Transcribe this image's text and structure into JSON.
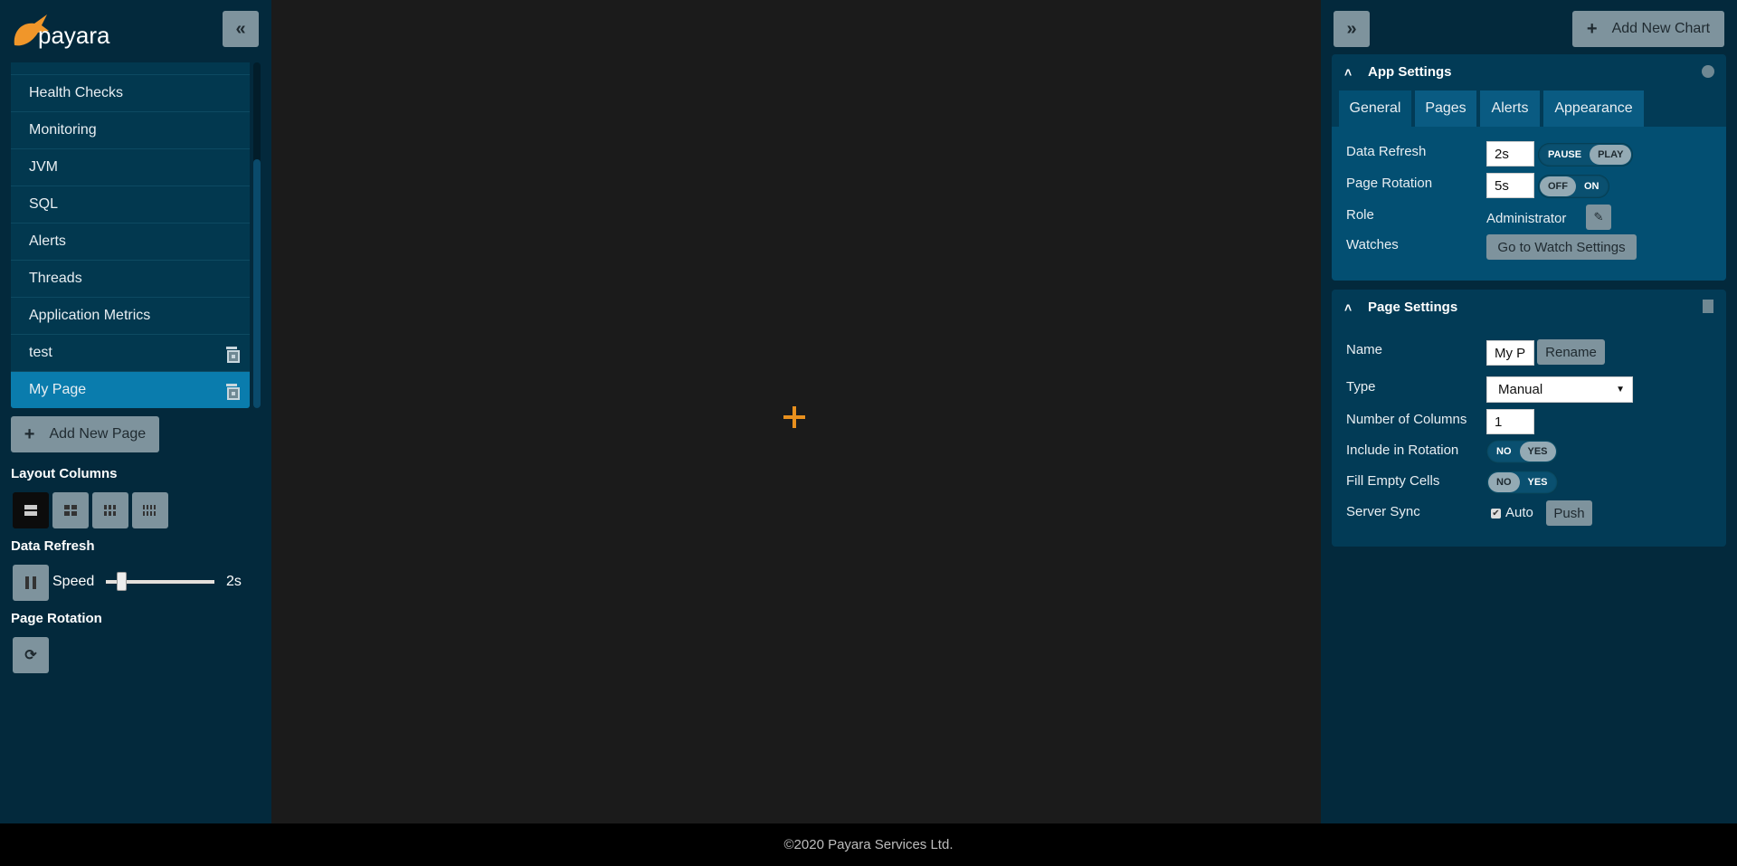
{
  "brand": {
    "logo_text": "payara"
  },
  "sidebar": {
    "items": [
      {
        "label": "Health Checks"
      },
      {
        "label": "Monitoring"
      },
      {
        "label": "JVM"
      },
      {
        "label": "SQL"
      },
      {
        "label": "Alerts"
      },
      {
        "label": "Threads"
      },
      {
        "label": "Application Metrics"
      },
      {
        "label": "test",
        "deletable": true
      },
      {
        "label": "My Page",
        "deletable": true,
        "active": true
      }
    ],
    "add_page_label": "Add New Page",
    "layout_columns_label": "Layout Columns",
    "layout_columns_selected": 1,
    "data_refresh_label": "Data Refresh",
    "speed_label": "Speed",
    "speed_value": "2s",
    "page_rotation_label": "Page Rotation"
  },
  "right": {
    "add_chart_label": "Add New Chart",
    "app_settings": {
      "title": "App Settings",
      "tabs": [
        "General",
        "Pages",
        "Alerts",
        "Appearance"
      ],
      "active_tab": "General",
      "data_refresh_label": "Data Refresh",
      "data_refresh_value": "2s",
      "pause": "PAUSE",
      "play": "PLAY",
      "page_rotation_label": "Page Rotation",
      "page_rotation_value": "5s",
      "off": "OFF",
      "on": "ON",
      "role_label": "Role",
      "role_value": "Administrator",
      "watches_label": "Watches",
      "watch_button": "Go to Watch Settings"
    },
    "page_settings": {
      "title": "Page Settings",
      "name_label": "Name",
      "name_value": "My P",
      "rename": "Rename",
      "type_label": "Type",
      "type_value": "Manual",
      "columns_label": "Number of Columns",
      "columns_value": "1",
      "rotation_label": "Include in Rotation",
      "no": "NO",
      "yes": "YES",
      "fill_label": "Fill Empty Cells",
      "sync_label": "Server Sync",
      "auto": "Auto",
      "push": "Push"
    }
  },
  "footer": {
    "text": "©2020 Payara Services Ltd."
  },
  "colors": {
    "accent": "#e8901e",
    "active_nav": "#0a7cad",
    "button": "#7e939d"
  }
}
